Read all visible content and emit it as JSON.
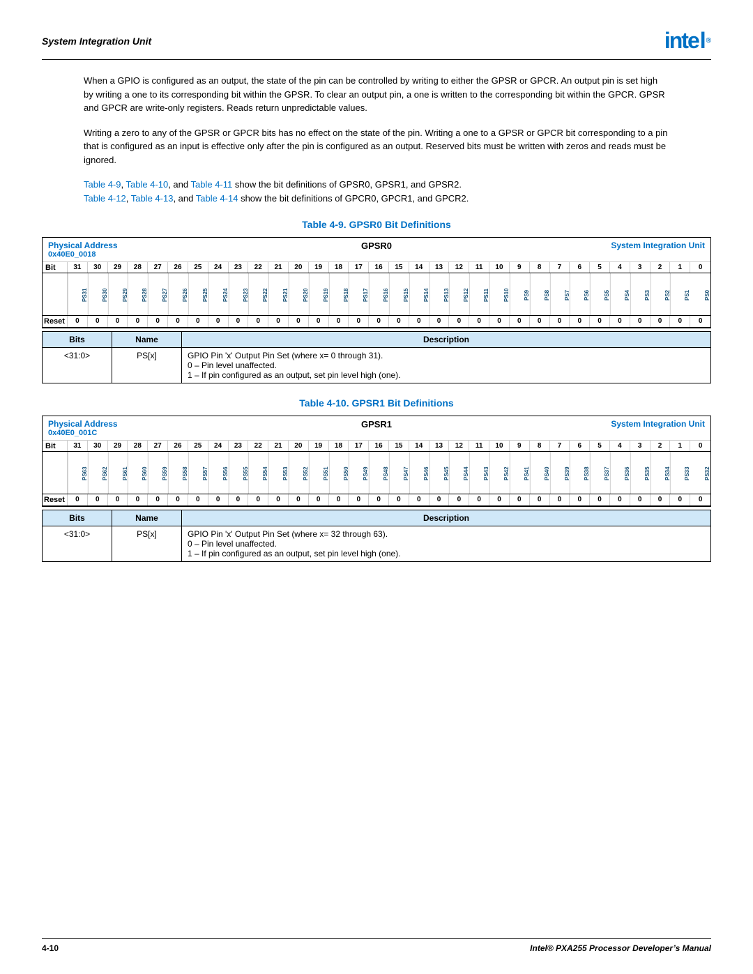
{
  "header": {
    "title": "System Integration Unit",
    "logo": "int⋅l"
  },
  "body_paragraphs": [
    "When a GPIO is configured as an output, the state of the pin can be controlled by writing to either the GPSR or GPCR. An output pin is set high by writing a one to its corresponding bit within the GPSR. To clear an output pin, a one is written to the corresponding bit within the GPCR. GPSR and GPCR are write-only registers. Reads return unpredictable values.",
    "Writing a zero to any of the GPSR or GPCR bits has no effect on the state of the pin. Writing a one to a GPSR or GPCR bit corresponding to a pin that is configured as an input is effective only after the pin is configured as an output. Reserved bits must be written with zeros and reads must be ignored."
  ],
  "ref_line1": "Table 4-9, Table 4-10, and Table 4-11 show the bit definitions of GPSR0, GPSR1, and GPSR2.",
  "ref_line2": "Table 4-12, Table 4-13, and Table 4-14 show the bit definitions of GPCR0, GPCR1, and GPCR2.",
  "table9": {
    "title": "Table 4-9. GPSR0 Bit Definitions",
    "physical_address_label": "Physical Address",
    "physical_address_value": "0x40E0_0018",
    "reg_name": "GPSR0",
    "unit": "System Integration Unit",
    "bit_numbers": [
      "31",
      "30",
      "29",
      "28",
      "27",
      "26",
      "25",
      "24",
      "23",
      "22",
      "21",
      "20",
      "19",
      "18",
      "17",
      "16",
      "15",
      "14",
      "13",
      "12",
      "11",
      "10",
      "9",
      "8",
      "7",
      "6",
      "5",
      "4",
      "3",
      "2",
      "1",
      "0"
    ],
    "bit_names": [
      "PS31",
      "PS30",
      "PS29",
      "PS28",
      "PS27",
      "PS26",
      "PS25",
      "PS24",
      "PS23",
      "PS22",
      "PS21",
      "PS20",
      "PS19",
      "PS18",
      "PS17",
      "PS16",
      "PS15",
      "PS14",
      "PS13",
      "PS12",
      "PS11",
      "PS10",
      "PS9",
      "PS8",
      "PS7",
      "PS6",
      "PS5",
      "PS4",
      "PS3",
      "PS2",
      "PS1",
      "PS0"
    ],
    "reset_values": [
      "0",
      "0",
      "0",
      "0",
      "0",
      "0",
      "0",
      "0",
      "0",
      "0",
      "0",
      "0",
      "0",
      "0",
      "0",
      "0",
      "0",
      "0",
      "0",
      "0",
      "0",
      "0",
      "0",
      "0",
      "0",
      "0",
      "0",
      "0",
      "0",
      "0",
      "0",
      "0"
    ],
    "reset_label": "Reset",
    "desc_headers": [
      "Bits",
      "Name",
      "Description"
    ],
    "desc_rows": [
      {
        "bits": "<31:0>",
        "name": "PS[x]",
        "desc_line1": "GPIO Pin 'x' Output Pin Set (where x= 0 through 31).",
        "desc_line2": "0 – Pin level unaffected.",
        "desc_line3": "1 – If pin configured as an output, set pin level high (one)."
      }
    ]
  },
  "table10": {
    "title": "Table 4-10. GPSR1 Bit Definitions",
    "physical_address_label": "Physical Address",
    "physical_address_value": "0x40E0_001C",
    "reg_name": "GPSR1",
    "unit": "System Integration Unit",
    "bit_numbers": [
      "31",
      "30",
      "29",
      "28",
      "27",
      "26",
      "25",
      "24",
      "23",
      "22",
      "21",
      "20",
      "19",
      "18",
      "17",
      "16",
      "15",
      "14",
      "13",
      "12",
      "11",
      "10",
      "9",
      "8",
      "7",
      "6",
      "5",
      "4",
      "3",
      "2",
      "1",
      "0"
    ],
    "bit_names": [
      "PS63",
      "PS62",
      "PS61",
      "PS60",
      "PS59",
      "PS58",
      "PS57",
      "PS56",
      "PS55",
      "PS54",
      "PS53",
      "PS52",
      "PS51",
      "PS50",
      "PS49",
      "PS48",
      "PS47",
      "PS46",
      "PS45",
      "PS44",
      "PS43",
      "PS42",
      "PS41",
      "PS40",
      "PS39",
      "PS38",
      "PS37",
      "PS36",
      "PS35",
      "PS34",
      "PS33",
      "PS32"
    ],
    "reset_values": [
      "0",
      "0",
      "0",
      "0",
      "0",
      "0",
      "0",
      "0",
      "0",
      "0",
      "0",
      "0",
      "0",
      "0",
      "0",
      "0",
      "0",
      "0",
      "0",
      "0",
      "0",
      "0",
      "0",
      "0",
      "0",
      "0",
      "0",
      "0",
      "0",
      "0",
      "0",
      "0"
    ],
    "reset_label": "Reset",
    "desc_headers": [
      "Bits",
      "Name",
      "Description"
    ],
    "desc_rows": [
      {
        "bits": "<31:0>",
        "name": "PS[x]",
        "desc_line1": "GPIO Pin 'x' Output Pin Set (where x= 32 through 63).",
        "desc_line2": "0 – Pin level unaffected.",
        "desc_line3": "1 – If pin configured as an output, set pin level high (one)."
      }
    ]
  },
  "footer": {
    "left": "4-10",
    "right": "Intel® PXA255 Processor Developer’s Manual"
  }
}
